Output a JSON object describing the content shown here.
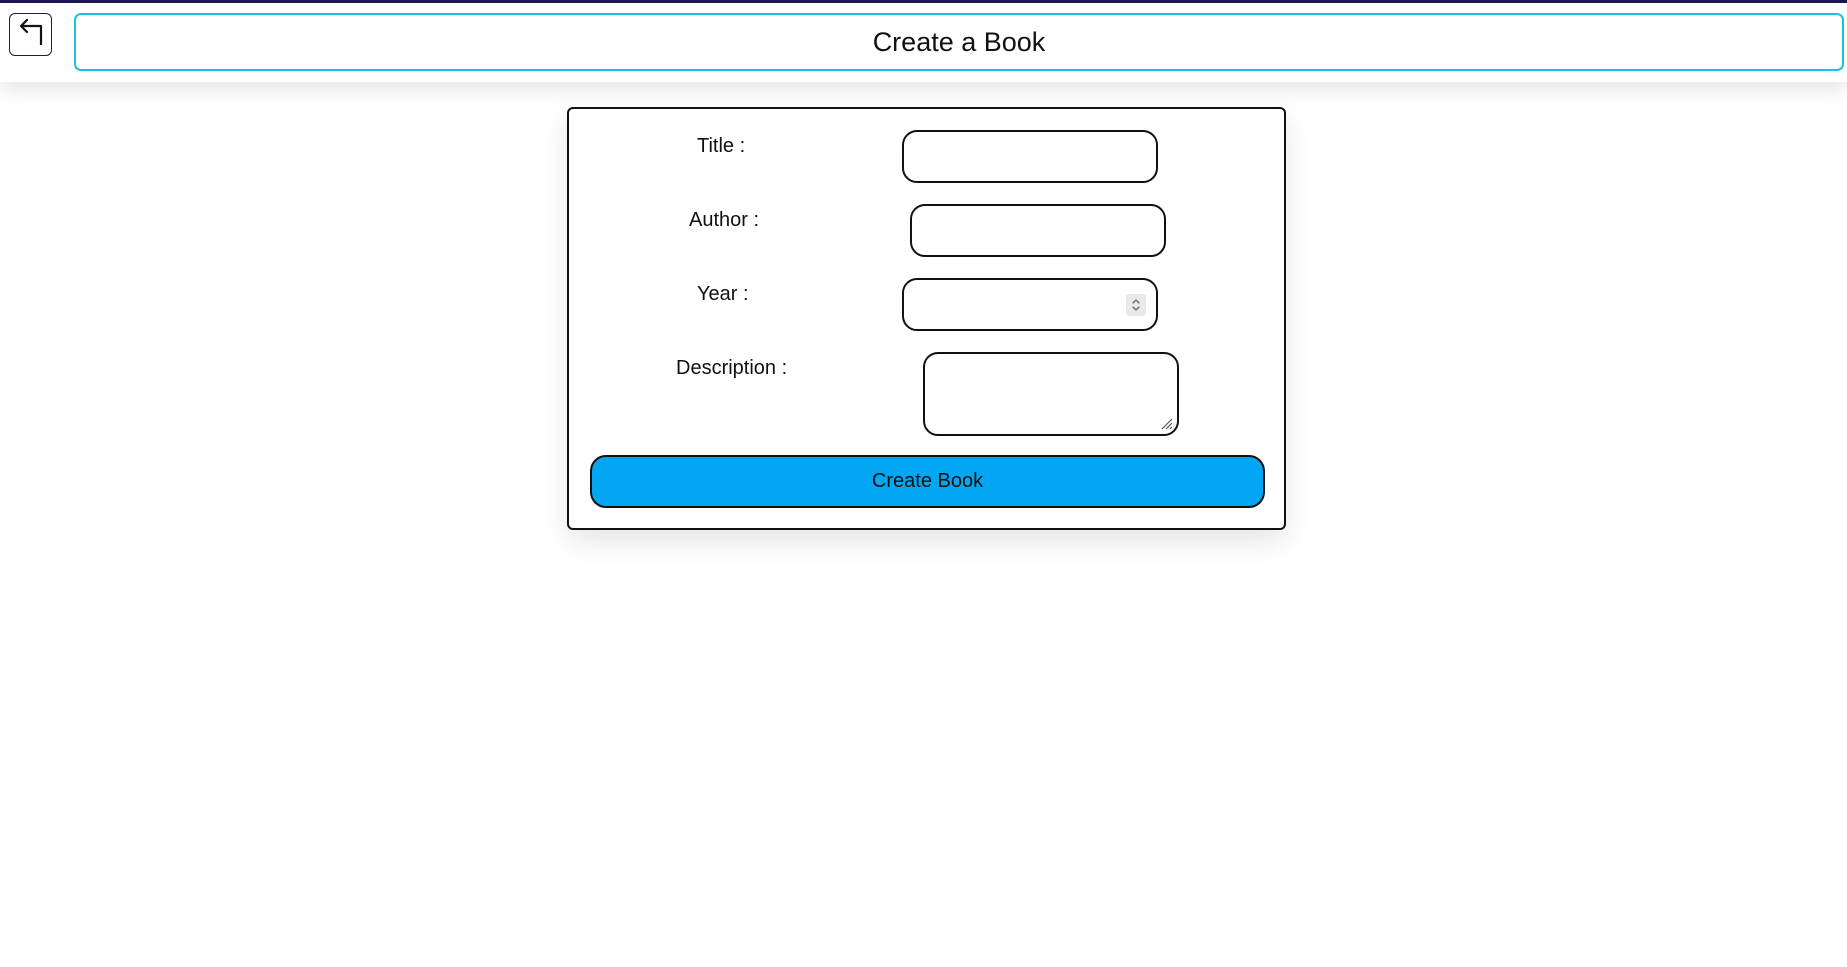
{
  "header": {
    "back_icon": "back-arrow-icon",
    "title": "Create a Book"
  },
  "form": {
    "title": {
      "label": "Title :",
      "value": ""
    },
    "author": {
      "label": "Author :",
      "value": ""
    },
    "year": {
      "label": "Year :",
      "value": "",
      "spinner_icon": "chevron-up-down-icon"
    },
    "description": {
      "label": "Description :",
      "value": ""
    },
    "submit_label": "Create Book"
  },
  "colors": {
    "accent_border": "#19c3de",
    "button_bg": "#03a6f3",
    "top_strip": "#1d1650"
  }
}
